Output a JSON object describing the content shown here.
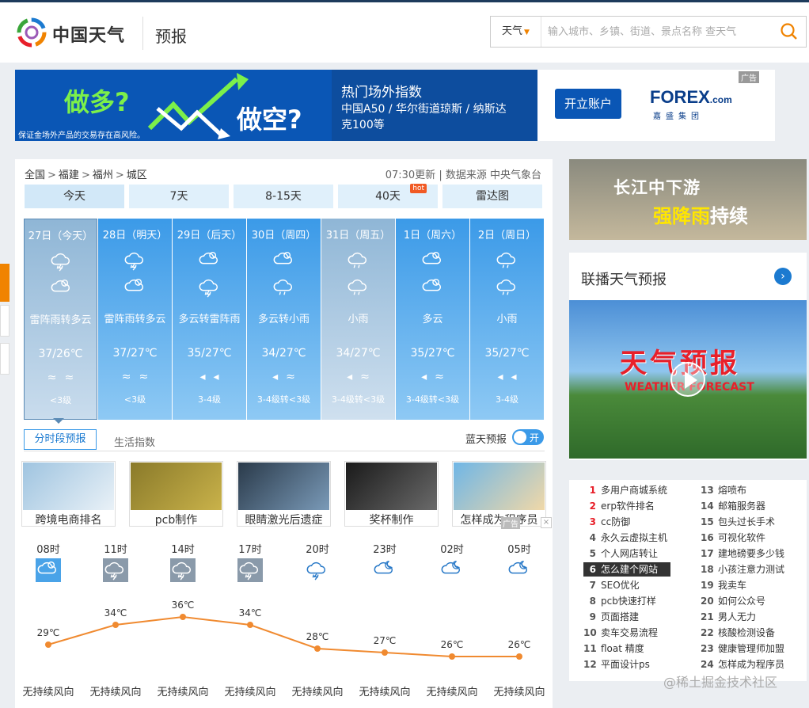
{
  "header": {
    "logo_text": "中国天气",
    "section": "预报",
    "search_type": "天气",
    "search_placeholder": "输入城市、乡镇、街道、景点名称 查天气"
  },
  "ad": {
    "left_big1": "做多?",
    "left_big2": "做空?",
    "disclaimer": "保证金场外产品的交易存在高风险。",
    "title": "热门场外指数",
    "desc": "中国A50 / 华尔街道琼斯 / 纳斯达克100等",
    "button": "开立账户",
    "brand": "FOREX",
    "brand_suffix": ".com",
    "brand_sub": "嘉盛集团",
    "tag": "广告"
  },
  "breadcrumb": [
    "全国",
    "福建",
    "福州",
    "城区"
  ],
  "update": {
    "time": "07:30更新",
    "sep": "|",
    "source": "数据来源 中央气象台"
  },
  "tabs": [
    {
      "label": "今天"
    },
    {
      "label": "7天"
    },
    {
      "label": "8-15天"
    },
    {
      "label": "40天",
      "badge": "hot"
    },
    {
      "label": "雷达图"
    }
  ],
  "days": [
    {
      "date": "27日（今天）",
      "desc": "雷阵雨转多云",
      "temp": "37/26℃",
      "wind": "≈≈",
      "level": "<3级",
      "icon1": "thunder-rain-icon",
      "icon2": "partly-cloudy-icon"
    },
    {
      "date": "28日（明天）",
      "desc": "雷阵雨转多云",
      "temp": "37/27℃",
      "wind": "≈≈",
      "level": "<3级",
      "icon1": "thunder-rain-icon",
      "icon2": "partly-cloudy-icon"
    },
    {
      "date": "29日（后天）",
      "desc": "多云转雷阵雨",
      "temp": "35/27℃",
      "wind": "◂◂",
      "level": "3-4级",
      "icon1": "partly-cloudy-icon",
      "icon2": "thunder-rain-icon"
    },
    {
      "date": "30日（周四）",
      "desc": "多云转小雨",
      "temp": "34/27℃",
      "wind": "◂≈",
      "level": "3-4级转<3级",
      "icon1": "partly-cloudy-icon",
      "icon2": "light-rain-icon"
    },
    {
      "date": "31日（周五）",
      "desc": "小雨",
      "temp": "34/27℃",
      "wind": "◂≈",
      "level": "3-4级转<3级",
      "icon1": "light-rain-icon",
      "icon2": "light-rain-icon"
    },
    {
      "date": "1日（周六）",
      "desc": "多云",
      "temp": "35/27℃",
      "wind": "◂≈",
      "level": "3-4级转<3级",
      "icon1": "partly-cloudy-icon",
      "icon2": "partly-cloudy-icon"
    },
    {
      "date": "2日（周日）",
      "desc": "小雨",
      "temp": "35/27℃",
      "wind": "◂◂",
      "level": "3-4级",
      "icon1": "light-rain-icon",
      "icon2": "light-rain-icon"
    }
  ],
  "subtabs": {
    "hourly": "分时段预报",
    "life": "生活指数",
    "blue_sky": "蓝天预报",
    "toggle": "开"
  },
  "thumbs": [
    {
      "caption": "跨境电商排名"
    },
    {
      "caption": "pcb制作"
    },
    {
      "caption": "眼睛激光后遗症"
    },
    {
      "caption": "奖杯制作"
    },
    {
      "caption": "怎样成为程序员"
    }
  ],
  "thumbs_ad_tag": "广告",
  "hourly": [
    {
      "time": "08时",
      "temp": "29℃",
      "t": 29,
      "wind": "无持续风向",
      "icon": "cloudy-sun-icon"
    },
    {
      "time": "11时",
      "temp": "34℃",
      "t": 34,
      "wind": "无持续风向",
      "icon": "thunder-rain-icon"
    },
    {
      "time": "14时",
      "temp": "36℃",
      "t": 36,
      "wind": "无持续风向",
      "icon": "thunder-rain-icon"
    },
    {
      "time": "17时",
      "temp": "34℃",
      "t": 34,
      "wind": "无持续风向",
      "icon": "thunder-rain-icon"
    },
    {
      "time": "20时",
      "temp": "28℃",
      "t": 28,
      "wind": "无持续风向",
      "icon": "thunder-rain-night-icon"
    },
    {
      "time": "23时",
      "temp": "27℃",
      "t": 27,
      "wind": "无持续风向",
      "icon": "cloudy-night-icon"
    },
    {
      "time": "02时",
      "temp": "26℃",
      "t": 26,
      "wind": "无持续风向",
      "icon": "cloudy-night-icon"
    },
    {
      "time": "05时",
      "temp": "26℃",
      "t": 26,
      "wind": "无持续风向",
      "icon": "cloudy-night-icon"
    }
  ],
  "promo": {
    "line1": "长江中下游",
    "line2_hl": "强降雨",
    "line2": "持续"
  },
  "broadcast": {
    "title": "联播天气预报",
    "video_title": "天气预报",
    "video_sub": "WEATHER FORECAST"
  },
  "rank": [
    {
      "n": "1",
      "text": "多用户商城系统"
    },
    {
      "n": "2",
      "text": "erp软件排名"
    },
    {
      "n": "3",
      "text": "cc防御"
    },
    {
      "n": "4",
      "text": "永久云虚拟主机"
    },
    {
      "n": "5",
      "text": "个人网店转让"
    },
    {
      "n": "6",
      "text": "怎么建个网站"
    },
    {
      "n": "7",
      "text": "SEO优化"
    },
    {
      "n": "8",
      "text": "pcb快速打样"
    },
    {
      "n": "9",
      "text": "页面搭建"
    },
    {
      "n": "10",
      "text": "卖车交易流程"
    },
    {
      "n": "11",
      "text": "float 精度"
    },
    {
      "n": "12",
      "text": "平面设计ps"
    },
    {
      "n": "13",
      "text": "熔喷布"
    },
    {
      "n": "14",
      "text": "邮箱服务器"
    },
    {
      "n": "15",
      "text": "包头过长手术"
    },
    {
      "n": "16",
      "text": "可视化软件"
    },
    {
      "n": "17",
      "text": "建地磅要多少钱"
    },
    {
      "n": "18",
      "text": "小孩注意力测试"
    },
    {
      "n": "19",
      "text": "我卖车"
    },
    {
      "n": "20",
      "text": "如何公众号"
    },
    {
      "n": "21",
      "text": "男人无力"
    },
    {
      "n": "22",
      "text": "核酸检测设备"
    },
    {
      "n": "23",
      "text": "健康管理师加盟"
    },
    {
      "n": "24",
      "text": "怎样成为程序员"
    }
  ],
  "watermark": "@稀土掘金技术社区",
  "colors": {
    "accent": "#1b7ad0",
    "orange": "#f08300",
    "line": "#f08a30"
  }
}
